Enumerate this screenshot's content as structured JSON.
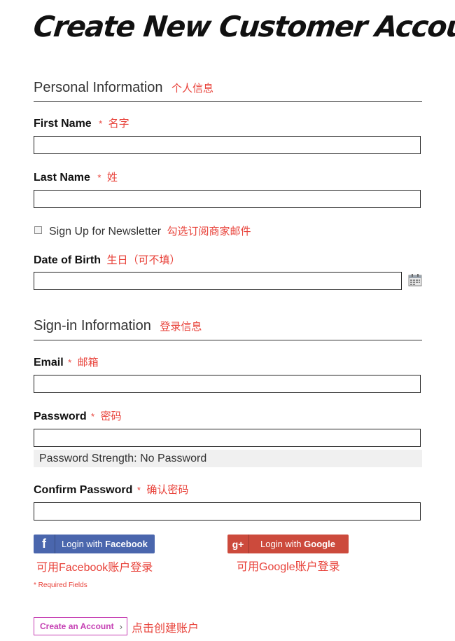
{
  "page": {
    "title": "Create New Customer Account"
  },
  "personal": {
    "section_title": "Personal Information",
    "section_note": "个人信息",
    "first_name": {
      "label": "First Name",
      "required_mark": "*",
      "note": "名字",
      "value": ""
    },
    "last_name": {
      "label": "Last Name",
      "required_mark": "*",
      "note": "姓",
      "value": ""
    },
    "newsletter": {
      "label": "Sign Up for Newsletter",
      "note": "勾选订阅商家邮件",
      "checked": false
    },
    "dob": {
      "label": "Date of Birth",
      "note": "生日（可不填）",
      "value": "",
      "icon": "calendar-icon"
    }
  },
  "signin": {
    "section_title": "Sign-in Information",
    "section_note": "登录信息",
    "email": {
      "label": "Email",
      "required_mark": "*",
      "note": "邮箱",
      "value": ""
    },
    "password": {
      "label": "Password",
      "required_mark": "*",
      "note": "密码",
      "value": ""
    },
    "strength": "Password Strength: No Password",
    "confirm": {
      "label": "Confirm Password",
      "required_mark": "*",
      "note": "确认密码",
      "value": ""
    }
  },
  "social": {
    "facebook": {
      "prefix": "Login with ",
      "brand": "Facebook",
      "note": "可用Facebook账户登录",
      "icon_glyph": "f",
      "color": "#4a66ad"
    },
    "google": {
      "prefix": "Login with ",
      "brand": "Google",
      "note": "可用Google账户登录",
      "icon_glyph": "g+",
      "color": "#cc4a3c"
    }
  },
  "footer": {
    "required_note": "* Required Fields",
    "create_button": "Create an Account",
    "create_chevron": "›",
    "create_note": "点击创建账户"
  },
  "colors": {
    "accent_red": "#e8423a",
    "button_magenta": "#c53fb3"
  }
}
